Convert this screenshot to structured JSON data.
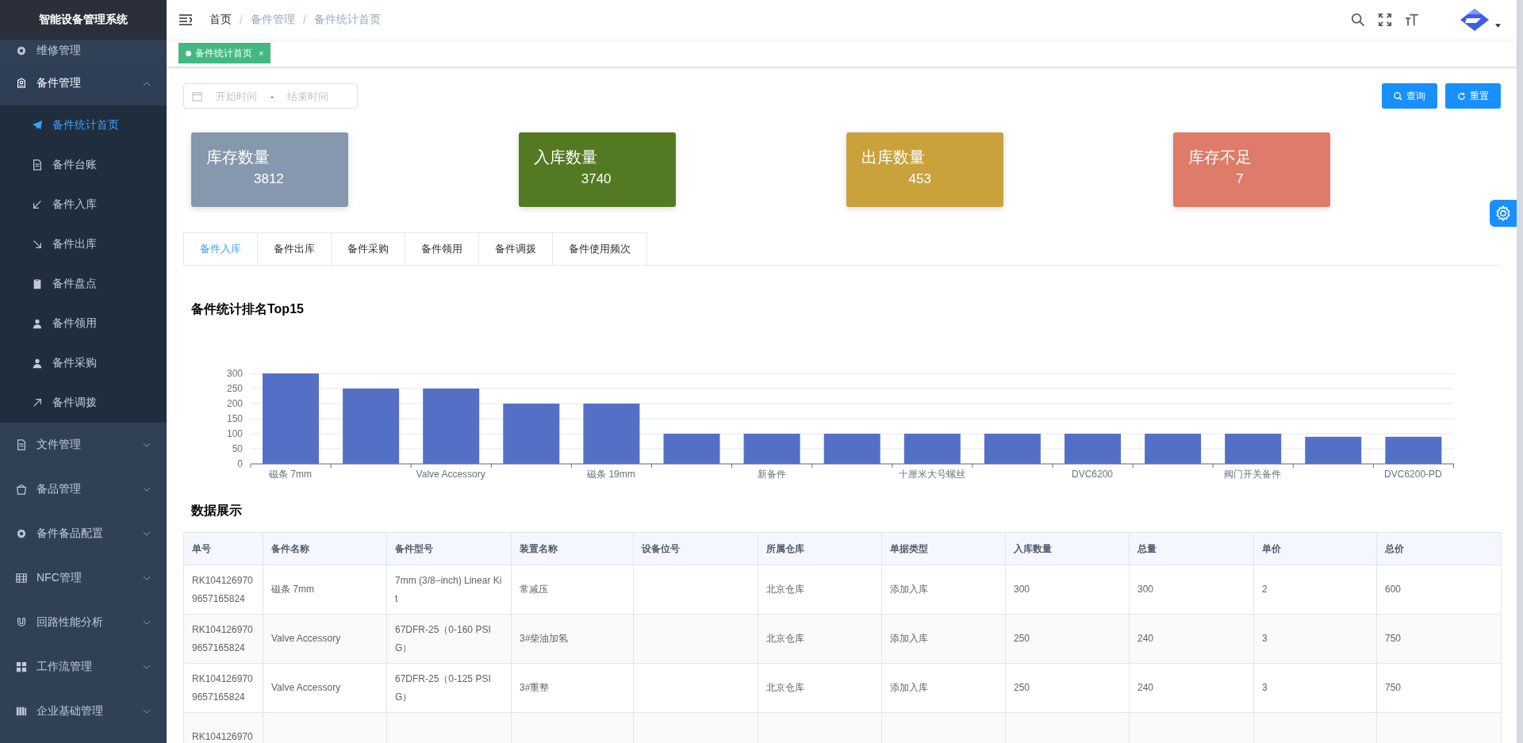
{
  "sidebar": {
    "title": "智能设备管理系统",
    "items": [
      {
        "label": "维修管理",
        "expanded": false
      },
      {
        "label": "备件管理",
        "expanded": true,
        "children": [
          {
            "label": "备件统计首页",
            "selected": true
          },
          {
            "label": "备件台账",
            "selected": false
          },
          {
            "label": "备件入库",
            "selected": false
          },
          {
            "label": "备件出库",
            "selected": false
          },
          {
            "label": "备件盘点",
            "selected": false
          },
          {
            "label": "备件领用",
            "selected": false
          },
          {
            "label": "备件采购",
            "selected": false
          },
          {
            "label": "备件调拨",
            "selected": false
          }
        ]
      },
      {
        "label": "文件管理",
        "expanded": false
      },
      {
        "label": "备品管理",
        "expanded": false
      },
      {
        "label": "备件备品配置",
        "expanded": false
      },
      {
        "label": "NFC管理",
        "expanded": false
      },
      {
        "label": "回路性能分析",
        "expanded": false
      },
      {
        "label": "工作流管理",
        "expanded": false
      },
      {
        "label": "企业基础管理",
        "expanded": false
      }
    ]
  },
  "breadcrumb": [
    "首页",
    "备件管理",
    "备件统计首页"
  ],
  "breadcrumb_separator": "/",
  "tags": [
    {
      "label": "备件统计首页",
      "close": "×",
      "selected": true
    }
  ],
  "filter": {
    "start_placeholder": "开始时间",
    "separator": "-",
    "end_placeholder": "结束时间",
    "buttons": [
      {
        "label": "查询",
        "kind": "search"
      },
      {
        "label": "重置",
        "kind": "reset"
      }
    ]
  },
  "cards": [
    {
      "label": "库存数量",
      "value": "3812",
      "color": "#8598ae"
    },
    {
      "label": "入库数量",
      "value": "3740",
      "color": "#537a22"
    },
    {
      "label": "出库数量",
      "value": "453",
      "color": "#c9a23c"
    },
    {
      "label": "库存不足",
      "value": "7",
      "color": "#de7b69"
    }
  ],
  "tabs": [
    {
      "label": "备件入库",
      "selected": true
    },
    {
      "label": "备件出库",
      "selected": false
    },
    {
      "label": "备件采购",
      "selected": false
    },
    {
      "label": "备件领用",
      "selected": false
    },
    {
      "label": "备件调拨",
      "selected": false
    },
    {
      "label": "备件使用频次",
      "selected": false
    }
  ],
  "chart": {
    "title": "备件统计排名Top15",
    "chart_data": {
      "type": "bar",
      "categories": [
        "磁条 7mm",
        null,
        "Valve Accessory",
        null,
        "磁条 19mm",
        null,
        "新备件",
        null,
        "十厘米大号螺丝",
        null,
        "DVC6200",
        null,
        "阀门开关备件",
        null,
        "DVC6200-PD"
      ],
      "values": [
        300,
        250,
        250,
        200,
        200,
        100,
        100,
        100,
        100,
        100,
        100,
        100,
        100,
        90,
        90
      ],
      "grid": true,
      "ylim": [
        0,
        300
      ],
      "yticks": [
        0,
        50,
        100,
        150,
        200,
        250,
        300
      ]
    }
  },
  "table": {
    "title": "数据展示",
    "columns": [
      "单号",
      "备件名称",
      "备件型号",
      "装置名称",
      "设备位号",
      "所属仓库",
      "单据类型",
      "入库数量",
      "总量",
      "单价",
      "总价"
    ],
    "rows": [
      [
        "RK1041269709657165824",
        "磁条 7mm",
        "7mm (3/8−inch) Linear Kit",
        "常减压",
        "",
        "北京仓库",
        "添加入库",
        "300",
        "300",
        "2",
        "600"
      ],
      [
        "RK1041269709657165824",
        "Valve Accessory",
        "67DFR-25（0-160 PSIG）",
        "3#柴油加氢",
        "",
        "北京仓库",
        "添加入库",
        "250",
        "240",
        "3",
        "750"
      ],
      [
        "RK1041269709657165824",
        "Valve Accessory",
        "67DFR-25（0-125 PSIG）",
        "3#重整",
        "",
        "北京仓库",
        "添加入库",
        "250",
        "240",
        "3",
        "750"
      ],
      [
        "RK104126970",
        "",
        "",
        "",
        "",
        "",
        "",
        "",
        "",
        "",
        ""
      ]
    ]
  }
}
